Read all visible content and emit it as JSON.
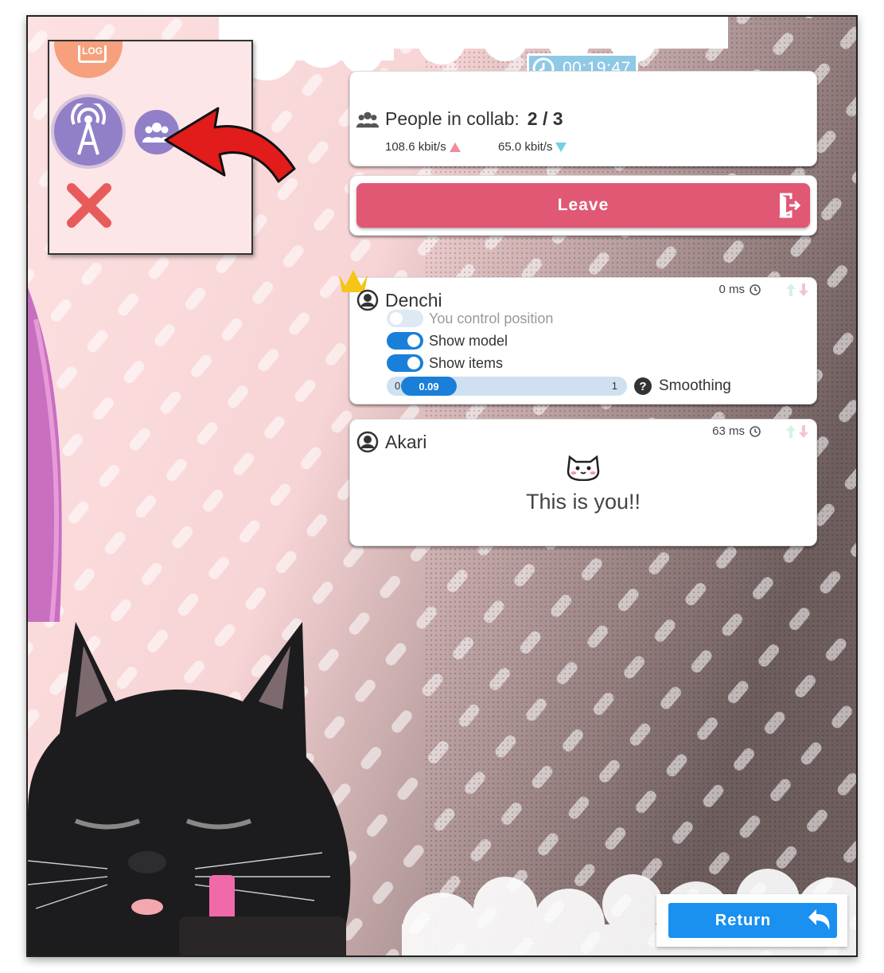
{
  "session": {
    "timer": "00:19:47"
  },
  "collab": {
    "label": "People in collab:",
    "count": "2 / 3",
    "upload": "108.6 kbit/s",
    "download": "65.0 kbit/s"
  },
  "leave": {
    "label": "Leave"
  },
  "users": [
    {
      "name": "Denchi",
      "ping": "0 ms",
      "toggles": [
        {
          "label": "You control position",
          "state": "off"
        },
        {
          "label": "Show model",
          "state": "on"
        },
        {
          "label": "Show items",
          "state": "on"
        }
      ],
      "smoothing": {
        "min": "0",
        "max": "1",
        "value": "0.09",
        "fraction": 0.09,
        "label": "Smoothing"
      }
    },
    {
      "name": "Akari",
      "ping": "63 ms",
      "message": "This is you!!"
    }
  ],
  "side_panel": {
    "log_label": "LOG"
  },
  "return": {
    "label": "Return"
  },
  "colors": {
    "accent_blue": "#1a90f0",
    "leave_red": "#e05874",
    "timer_blue": "#8ec9e6",
    "purple": "#9180c8"
  }
}
